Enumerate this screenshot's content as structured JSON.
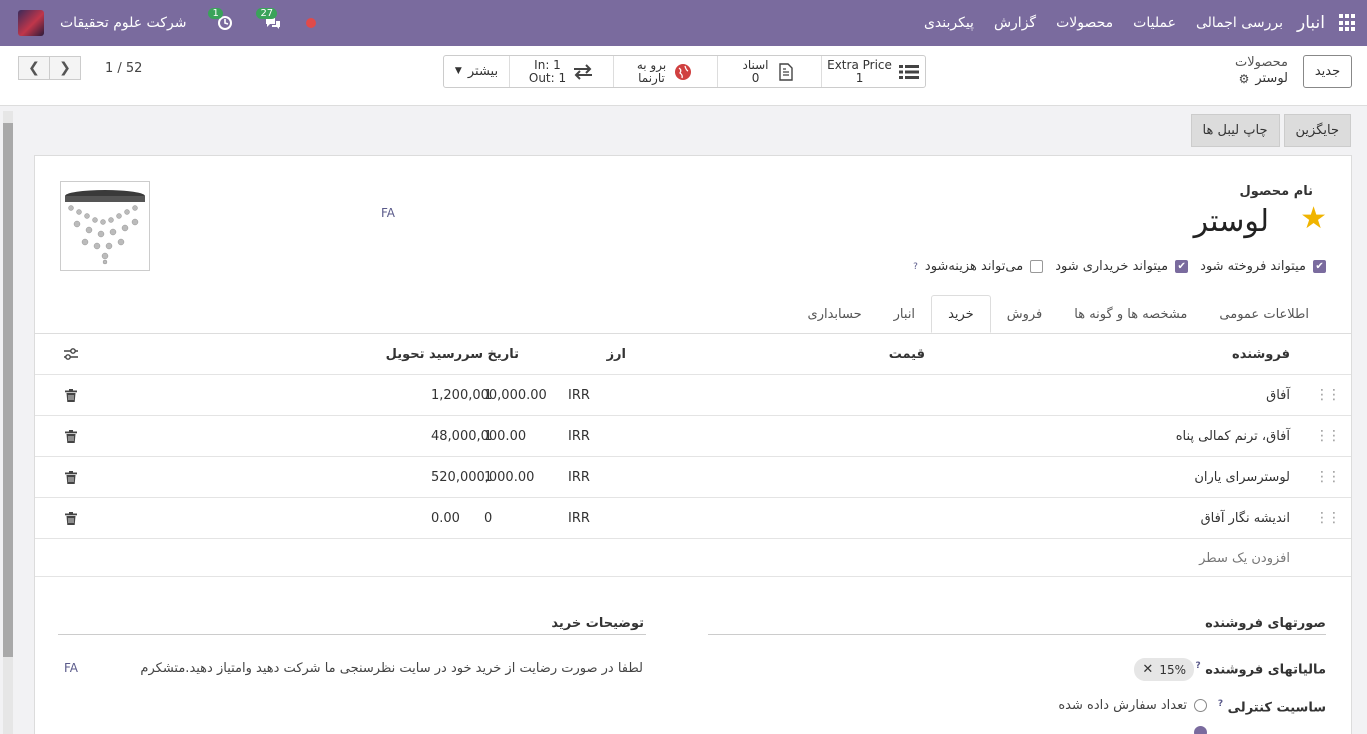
{
  "navbar": {
    "app_name": "انبار",
    "menu": [
      "بررسی اجمالی",
      "عملیات",
      "محصولات",
      "گزارش",
      "پیکربندی"
    ],
    "company": "شرکت علوم تحقیقات",
    "activity_count": "1",
    "messages_count": "27",
    "colors": {
      "bg": "#7a6b9e",
      "badge": "#3aa35a",
      "dot": "#e04a4a"
    }
  },
  "control": {
    "new_button": "جدید",
    "breadcrumb_parent": "محصولات",
    "breadcrumb_current": "لوستر",
    "stats": [
      {
        "label": "Extra Price",
        "value": "1",
        "icon": "list-icon"
      },
      {
        "label": "اسناد",
        "value": "0",
        "icon": "document-icon"
      },
      {
        "label": "برو به",
        "value": "تارنما",
        "icon": "globe-icon"
      },
      {
        "label": "In: 1",
        "value": "Out: 1",
        "icon": "transfer-icon"
      }
    ],
    "more": "بیشتر",
    "pager": "1 / 52"
  },
  "actions": {
    "print_labels": "چاپ لیبل ها",
    "replenish": "جایگزین"
  },
  "product": {
    "name_label": "نام محصول",
    "name": "لوستر",
    "lang": "FA",
    "can_be_sold": "میتواند فروخته شود",
    "can_be_purchased": "میتواند خریداری شود",
    "can_be_expensed": "می‌تواند هزینه‌شود",
    "help_mark": "?"
  },
  "tabs": [
    "اطلاعات عمومی",
    "مشخصه ها و گونه ها",
    "فروش",
    "خرید",
    "انبار",
    "حسابداری"
  ],
  "vendor_table": {
    "headers": {
      "vendor": "فروشنده",
      "price": "قیمت",
      "currency": "ارز",
      "delivery": "تاریخ سررسید تحویل"
    },
    "rows": [
      {
        "vendor": "آفاق",
        "price": "1,200,000,000.00",
        "currency": "IRR",
        "delivery": "1"
      },
      {
        "vendor": "آفاق، ترنم کمالی پناه",
        "price": "48,000,000.00",
        "currency": "IRR",
        "delivery": "1"
      },
      {
        "vendor": "لوسترسرای یاران",
        "price": "520,000,000.00",
        "currency": "IRR",
        "delivery": "1"
      },
      {
        "vendor": "اندیشه نگار آفاق",
        "price": "0.00",
        "currency": "IRR",
        "delivery": "0"
      }
    ],
    "add_line": "افزودن یک سطر"
  },
  "vendor_bills": {
    "title": "صورتهای فروشنده",
    "taxes_label": "مالیاتهای فروشنده",
    "tax_tag": "15%",
    "control_policy_label": "ساسیت کنترلی",
    "control_option": "تعداد سفارش داده شده"
  },
  "purchase_description": {
    "title": "توضیحات خرید",
    "text": "لطفا در صورت رضایت از خرید خود در سایت نظرسنجی ما  شرکت دهید وامتیاز دهید.متشکرم",
    "lang": "FA"
  }
}
